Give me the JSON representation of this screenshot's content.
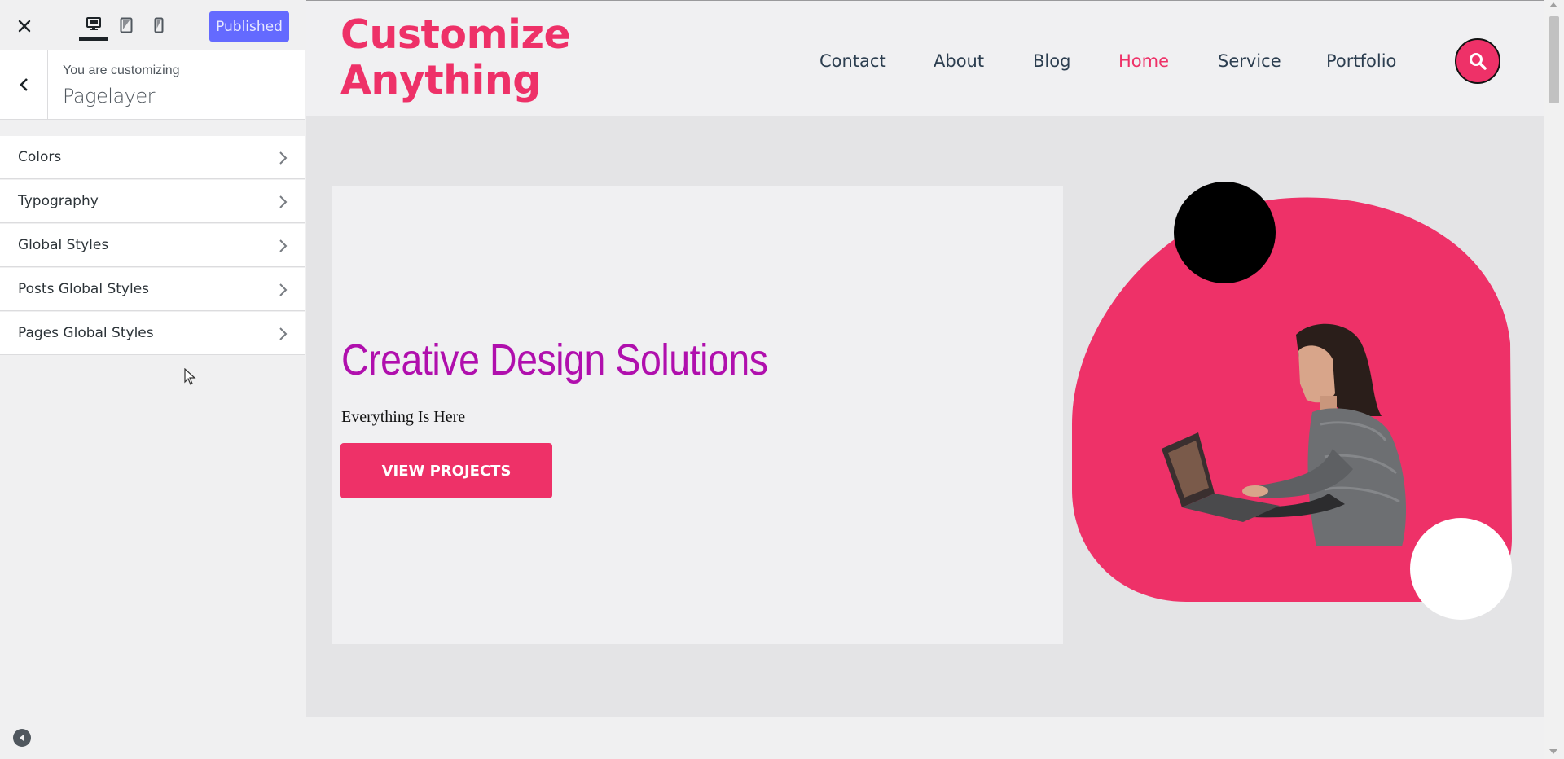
{
  "sidebar": {
    "close_icon": "close-icon",
    "devices": [
      {
        "name": "desktop",
        "icon": "desktop-icon",
        "active": true
      },
      {
        "name": "tablet",
        "icon": "tablet-icon",
        "active": false
      },
      {
        "name": "mobile",
        "icon": "mobile-icon",
        "active": false
      }
    ],
    "publish_label": "Published",
    "customizing_label": "You are customizing",
    "customizing_title": "Pagelayer",
    "sections": [
      {
        "label": "Colors"
      },
      {
        "label": "Typography"
      },
      {
        "label": "Global Styles"
      },
      {
        "label": "Posts Global Styles"
      },
      {
        "label": "Pages Global Styles"
      }
    ]
  },
  "site": {
    "logo_line1": "Customize",
    "logo_line2": "Anything",
    "nav": [
      {
        "label": "Contact",
        "active": false
      },
      {
        "label": "About",
        "active": false
      },
      {
        "label": "Blog",
        "active": false
      },
      {
        "label": "Home",
        "active": true
      },
      {
        "label": "Service",
        "active": false
      },
      {
        "label": "Portfolio",
        "active": false
      }
    ],
    "hero_title": "Creative Design Solutions",
    "hero_subtitle": "Everything Is Here",
    "hero_button": "VIEW PROJECTS"
  },
  "colors": {
    "brand_pink": "#ee3168",
    "hero_title": "#b00fad",
    "publish_button": "#646aff"
  }
}
